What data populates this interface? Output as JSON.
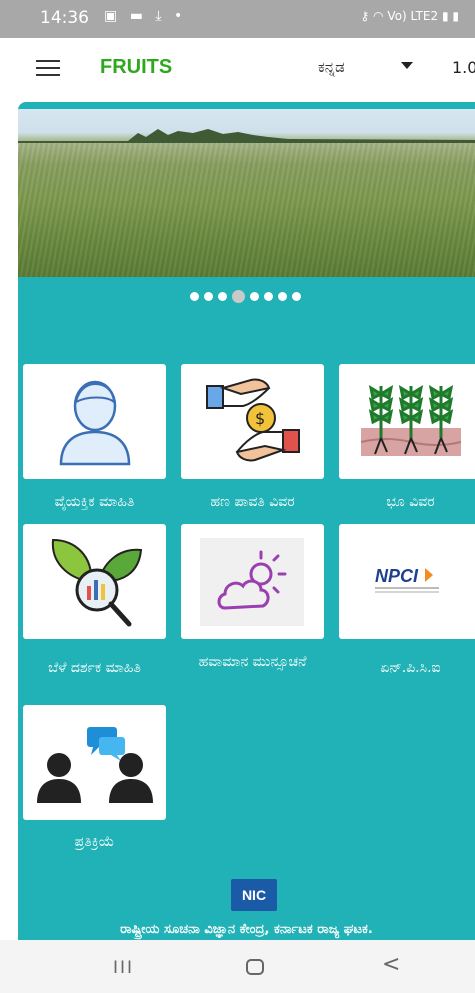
{
  "status_bar": {
    "time": "14:36",
    "left_icons": [
      "gallery-icon",
      "message-icon",
      "download-icon",
      "dot-icon"
    ],
    "right_icons": [
      "key-icon",
      "wifi-icon",
      "volte-icon",
      "signal-icon",
      "battery-icon"
    ],
    "right_text": "Vo) LTE2"
  },
  "app_bar": {
    "title": "FRUITS",
    "language": "ಕನ್ನಡ",
    "version": "1.0",
    "title_color": "#2ea81c"
  },
  "carousel": {
    "slide_count": 8,
    "active_index": 3
  },
  "tiles": [
    {
      "label": "ವೈಯಕ್ತಿಕ ಮಾಹಿತಿ",
      "icon": "person-icon"
    },
    {
      "label": "ಹಣ ಪಾವತಿ ವಿವರ",
      "icon": "money-transfer-icon"
    },
    {
      "label": "ಭೂ ವಿವರ",
      "icon": "crops-icon"
    },
    {
      "label": "ಬೆಳೆ ದರ್ಶಕ ಮಾಹಿತಿ",
      "icon": "leaf-magnifier-icon"
    },
    {
      "label": "ಹವಾಮಾನ ಮುನ್ಸೂಚನೆ",
      "icon": "weather-icon"
    },
    {
      "label": "ಏನ್.ಪಿ.ಸಿ.ಐ",
      "icon": "npci-logo"
    },
    {
      "label": "ಪ್ರತಿಕ್ರಿಯೆ",
      "icon": "feedback-icon"
    }
  ],
  "footer": {
    "logo_text": "NIC",
    "text": "ರಾಷ್ಟ್ರೀಯ ಸೂಚನಾ ವಿಜ್ಞಾನ ಕೇಂದ್ರ, ಕರ್ನಾಟಕ ರಾಜ್ಯ ಘಟಕ."
  },
  "nav_bar": {
    "recents": "III",
    "back": "<"
  },
  "colors": {
    "accent": "#20b2b6",
    "title": "#2ea81c"
  }
}
